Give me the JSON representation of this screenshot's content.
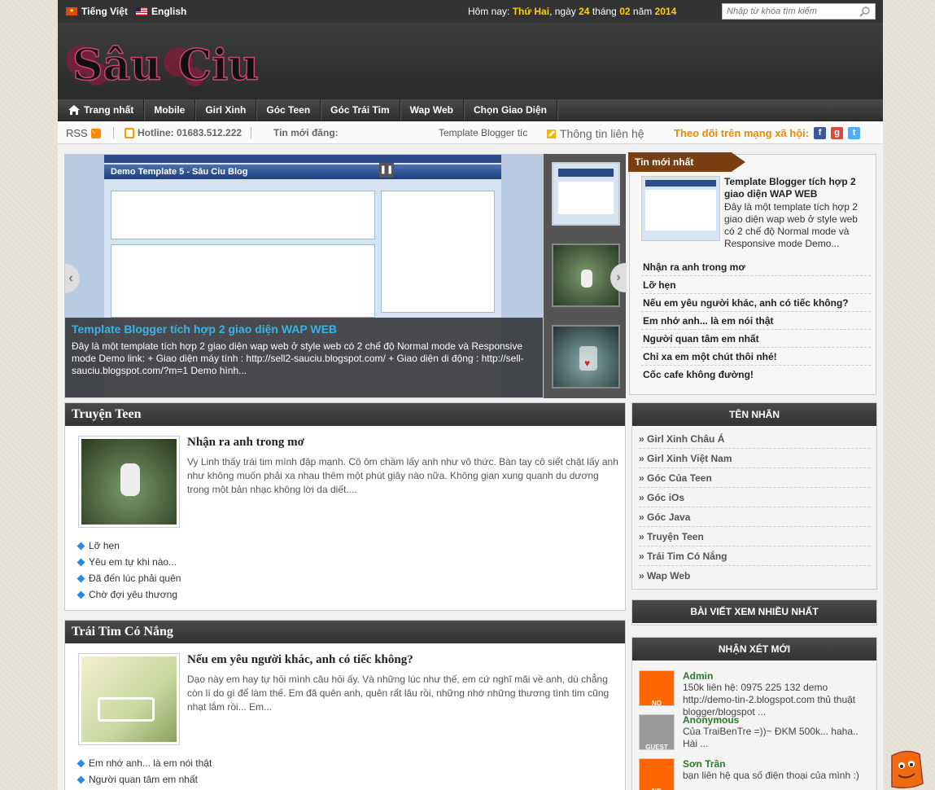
{
  "topbar": {
    "lang_vi": "Tiếng Việt",
    "lang_en": "English",
    "date_prefix": "Hôm nay:",
    "weekday": "Thứ Hai",
    "day_word": ", ngày",
    "day": "24",
    "month_word": "tháng",
    "month": "02",
    "year_word": "năm",
    "year": "2014",
    "search_placeholder": "Nhập từ khóa tìm kiếm"
  },
  "nav": {
    "items": [
      "Trang nhất",
      "Mobile",
      "Girl Xinh",
      "Góc Teen",
      "Góc Trái Tim",
      "Wap Web",
      "Chọn Giao Diện"
    ]
  },
  "ticker": {
    "rss": "RSS",
    "hotline": "Hotline: 01683.512.222",
    "new_label": "Tin mới đăng:",
    "new_item": "Template Blogger tíc",
    "contact": "Thông tin liên hệ",
    "follow": "Theo dõi trên mạng xã hội:"
  },
  "slider": {
    "demo_title": "Demo Template 5 - Sâu Ciu Blog",
    "title": "Template Blogger tích hợp 2 giao diện WAP WEB",
    "text": "Đây là một template tích hợp 2 giao diện wap web ở style web có 2 chế độ Normal mode và Responsive mode Demo link:  + Giao diện máy tính : http://sell2-sauciu.blogspot.com/ + Giao diện di động : http://sell-sauciu.blogspot.com/?m=1 Demo hình..."
  },
  "latest": {
    "tab": "Tin mới nhất",
    "feature_title": "Template Blogger tích hợp 2 giao diện WAP WEB",
    "feature_desc": "Đây là một template tích hợp 2 giao diện wap web ở style web có 2 chế độ Normal mode và Responsive mode Demo...",
    "items": [
      "Nhận ra anh trong mơ",
      "Lỡ hẹn",
      "Nếu em yêu người khác, anh có tiếc không?",
      "Em nhớ anh... là em nói thật",
      "Người quan tâm em nhất",
      "Chỉ xa em một chút thôi nhé!",
      "Cốc cafe không đường!"
    ]
  },
  "section1": {
    "title": "Truyện Teen",
    "post_title": "Nhận ra anh trong mơ",
    "post_desc": "Vy Linh thấy trái tim mình đập mạnh. Cô ôm chầm lấy anh như vô thức. Bàn tay cô siết chặt lấy anh như không muốn phải xa nhau thêm một phút giây nào nữa. Không gian xung quanh du dương trong một bản nhạc không lời da diết....",
    "related": [
      "Lỡ hẹn",
      "Yêu em tự khi nào...",
      "Đã đến lúc phải quên",
      "Chờ đợi yêu thương"
    ]
  },
  "section2": {
    "title": "Trái Tim Có Nắng",
    "post_title": "Nếu em yêu người khác, anh có tiếc không?",
    "post_desc": "Dạo này em hay tự hỏi mình câu hỏi ấy. Và những lúc như thế, em cứ nghĩ mãi về anh, dù chẳng còn lí do gì để làm thế. Em đã quên anh, quên rất lâu rồi, những nhớ những thương tình tim cũng nhạt lắm rồi... Em...",
    "related": [
      "Em nhớ anh... là em nói thật",
      "Người quan tâm em nhất"
    ]
  },
  "labels": {
    "title": "TÊN NHÃN",
    "items": [
      "Girl Xinh Châu Á",
      "Girl Xinh Việt Nam",
      "Góc Của Teen",
      "Góc iOs",
      "Góc Java",
      "Truyện Teen",
      "Trái Tim Có Nắng",
      "Wap Web"
    ]
  },
  "popular": {
    "title": "BÀI VIẾT XEM NHIỀU NHẤT"
  },
  "comments": {
    "title": "NHẬN XÉT MỚI",
    "items": [
      {
        "name": "Admin",
        "text": "150k liên hệ: 0975 225 132 demo http://demo-tin-2.blogspot.com thủ thuật blogger/blogspot ..."
      },
      {
        "name": "Anonymous",
        "text": "Của TraiBenTre =))~ ĐKM 500k... haha.. Hài ..."
      },
      {
        "name": "Sơn Trần",
        "text": "bạn liên hệ qua số điện thoại của mình :)"
      }
    ]
  },
  "colors": {
    "accent": "#ffd200",
    "link_blue": "#3ab3e6",
    "tab_brown": "#7a3e10",
    "orange": "#f08a00"
  }
}
